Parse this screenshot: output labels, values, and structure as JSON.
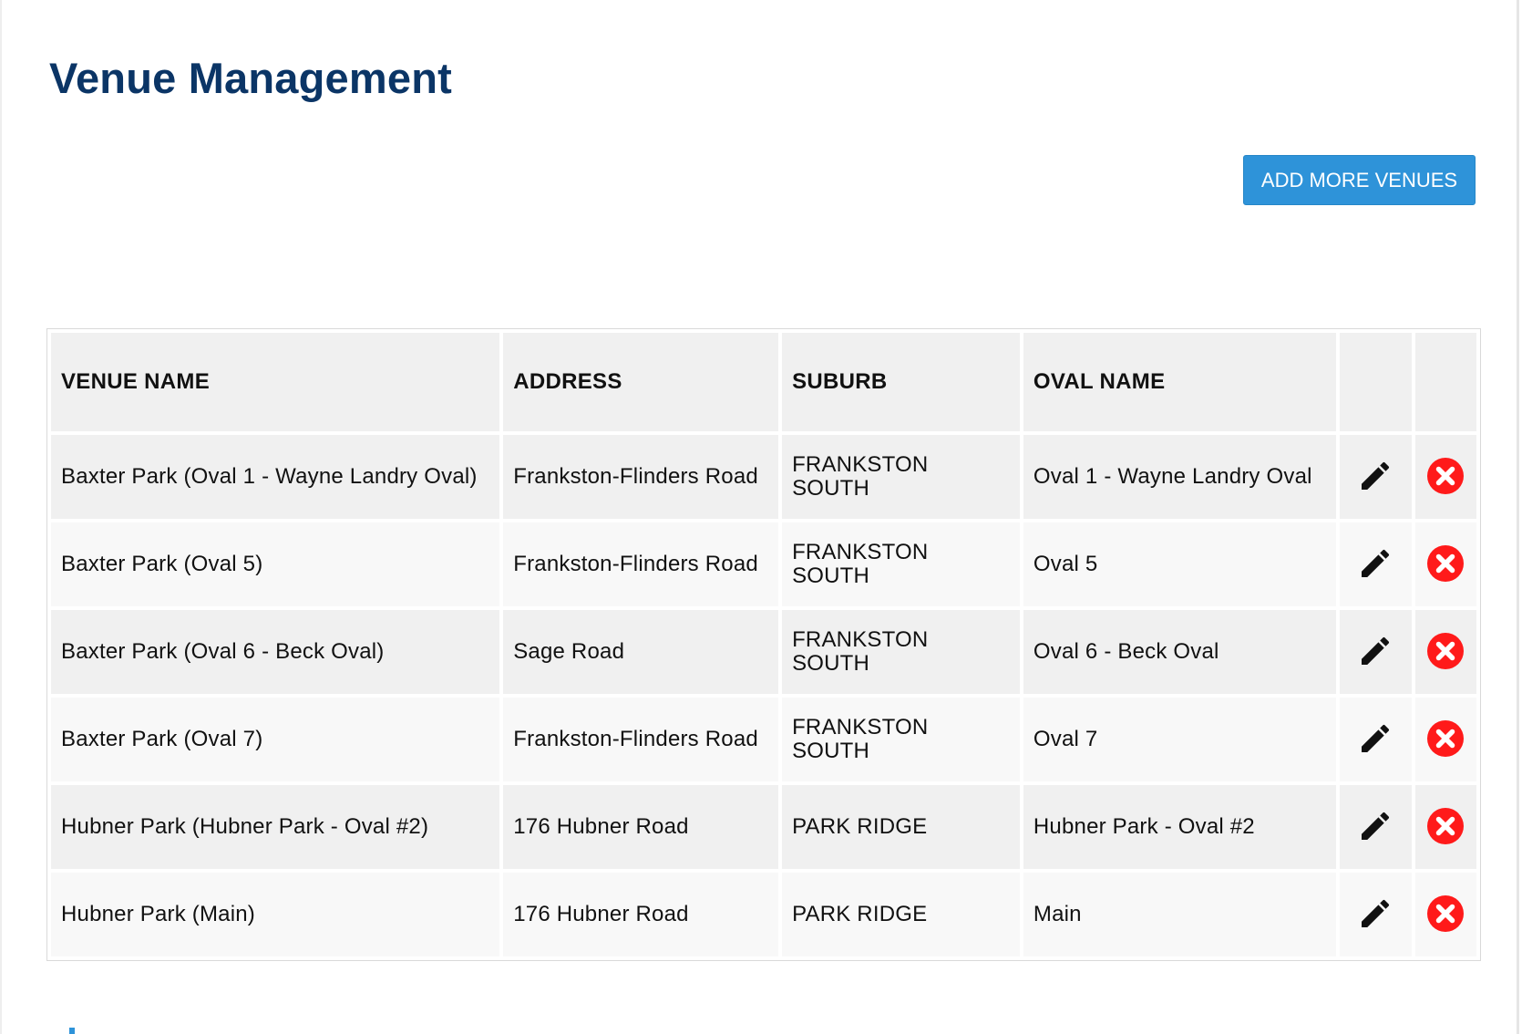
{
  "page": {
    "title": "Venue Management"
  },
  "toolbar": {
    "add_label": "ADD MORE VENUES"
  },
  "table": {
    "headers": {
      "venue_name": "VENUE NAME",
      "address": "ADDRESS",
      "suburb": "SUBURB",
      "oval_name": "OVAL NAME"
    },
    "rows": [
      {
        "venue_name": "Baxter Park (Oval 1 - Wayne Landry Oval)",
        "address": "Frankston-Flinders Road",
        "suburb": "FRANKSTON SOUTH",
        "oval_name": "Oval 1 - Wayne Landry Oval"
      },
      {
        "venue_name": "Baxter Park (Oval 5)",
        "address": "Frankston-Flinders Road",
        "suburb": "FRANKSTON SOUTH",
        "oval_name": "Oval 5"
      },
      {
        "venue_name": "Baxter Park (Oval 6 - Beck Oval)",
        "address": "Sage Road",
        "suburb": "FRANKSTON SOUTH",
        "oval_name": "Oval 6 - Beck Oval"
      },
      {
        "venue_name": "Baxter Park (Oval 7)",
        "address": "Frankston-Flinders Road",
        "suburb": "FRANKSTON SOUTH",
        "oval_name": "Oval 7"
      },
      {
        "venue_name": "Hubner Park (Hubner Park - Oval #2)",
        "address": "176 Hubner Road",
        "suburb": "PARK RIDGE",
        "oval_name": "Hubner Park - Oval #2"
      },
      {
        "venue_name": "Hubner Park (Main)",
        "address": "176 Hubner Road",
        "suburb": "PARK RIDGE",
        "oval_name": "Main"
      }
    ]
  },
  "icons": {
    "edit": "pencil-icon",
    "delete": "delete-icon"
  },
  "colors": {
    "title": "#0b3566",
    "accent": "#2e93d9",
    "delete": "#ff1a1a",
    "header_bg": "#f0f0f0"
  }
}
